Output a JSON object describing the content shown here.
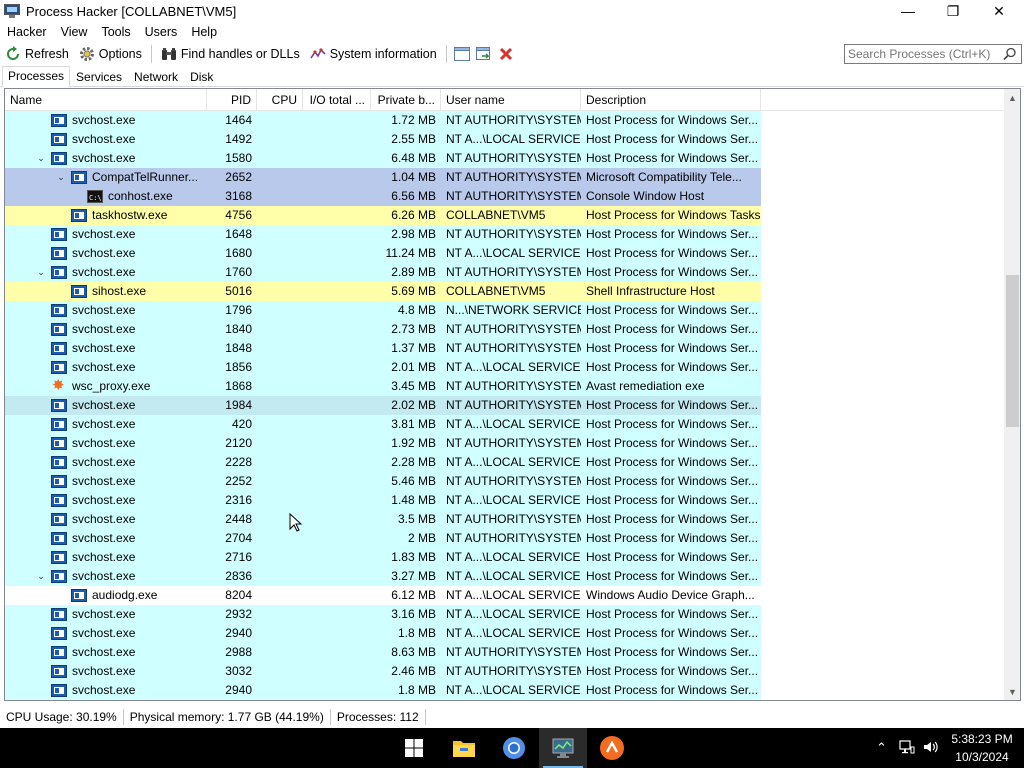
{
  "window": {
    "title": "Process Hacker [COLLABNET\\VM5]",
    "minimize": "—",
    "maximize": "❐",
    "close": "✕"
  },
  "menu": [
    "Hacker",
    "View",
    "Tools",
    "Users",
    "Help"
  ],
  "toolbar": {
    "refresh": "Refresh",
    "options": "Options",
    "find_handles": "Find handles or DLLs",
    "system_info": "System information",
    "search_placeholder": "Search Processes (Ctrl+K)"
  },
  "tabs": [
    "Processes",
    "Services",
    "Network",
    "Disk"
  ],
  "columns": [
    "Name",
    "PID",
    "CPU",
    "I/O total ...",
    "Private b...",
    "User name",
    "Description"
  ],
  "colors": {
    "service": "#d0ffff",
    "user": "#ffffaa",
    "selected": "#b9c9ec",
    "hover": "#c4eaf1",
    "plain": "#ffffff"
  },
  "processes": [
    {
      "name": "svchost.exe",
      "pid": "1464",
      "cpu": "",
      "io": "",
      "priv": "1.72 MB",
      "user": "NT AUTHORITY\\SYSTEM",
      "desc": "Host Process for Windows Ser...",
      "indent": 1,
      "twisty": "",
      "icon": "svc",
      "kind": "service"
    },
    {
      "name": "svchost.exe",
      "pid": "1492",
      "cpu": "",
      "io": "",
      "priv": "2.55 MB",
      "user": "NT A...\\LOCAL SERVICE",
      "desc": "Host Process for Windows Ser...",
      "indent": 1,
      "twisty": "",
      "icon": "svc",
      "kind": "service"
    },
    {
      "name": "svchost.exe",
      "pid": "1580",
      "cpu": "",
      "io": "",
      "priv": "6.48 MB",
      "user": "NT AUTHORITY\\SYSTEM",
      "desc": "Host Process for Windows Ser...",
      "indent": 1,
      "twisty": "⌄",
      "icon": "svc",
      "kind": "service"
    },
    {
      "name": "CompatTelRunner...",
      "pid": "2652",
      "cpu": "",
      "io": "",
      "priv": "1.04 MB",
      "user": "NT AUTHORITY\\SYSTEM",
      "desc": "Microsoft Compatibility Tele...",
      "indent": 2,
      "twisty": "⌄",
      "icon": "svc",
      "kind": "selected"
    },
    {
      "name": "conhost.exe",
      "pid": "3168",
      "cpu": "",
      "io": "",
      "priv": "6.56 MB",
      "user": "NT AUTHORITY\\SYSTEM",
      "desc": "Console Window Host",
      "indent": 3,
      "twisty": "",
      "icon": "cmd",
      "kind": "selected"
    },
    {
      "name": "taskhostw.exe",
      "pid": "4756",
      "cpu": "",
      "io": "",
      "priv": "6.26 MB",
      "user": "COLLABNET\\VM5",
      "desc": "Host Process for Windows Tasks",
      "indent": 2,
      "twisty": "",
      "icon": "svc",
      "kind": "user"
    },
    {
      "name": "svchost.exe",
      "pid": "1648",
      "cpu": "",
      "io": "",
      "priv": "2.98 MB",
      "user": "NT AUTHORITY\\SYSTEM",
      "desc": "Host Process for Windows Ser...",
      "indent": 1,
      "twisty": "",
      "icon": "svc",
      "kind": "service"
    },
    {
      "name": "svchost.exe",
      "pid": "1680",
      "cpu": "",
      "io": "",
      "priv": "11.24 MB",
      "user": "NT A...\\LOCAL SERVICE",
      "desc": "Host Process for Windows Ser...",
      "indent": 1,
      "twisty": "",
      "icon": "svc",
      "kind": "service"
    },
    {
      "name": "svchost.exe",
      "pid": "1760",
      "cpu": "",
      "io": "",
      "priv": "2.89 MB",
      "user": "NT AUTHORITY\\SYSTEM",
      "desc": "Host Process for Windows Ser...",
      "indent": 1,
      "twisty": "⌄",
      "icon": "svc",
      "kind": "service"
    },
    {
      "name": "sihost.exe",
      "pid": "5016",
      "cpu": "",
      "io": "",
      "priv": "5.69 MB",
      "user": "COLLABNET\\VM5",
      "desc": "Shell Infrastructure Host",
      "indent": 2,
      "twisty": "",
      "icon": "svc",
      "kind": "user"
    },
    {
      "name": "svchost.exe",
      "pid": "1796",
      "cpu": "",
      "io": "",
      "priv": "4.8 MB",
      "user": "N...\\NETWORK SERVICE",
      "desc": "Host Process for Windows Ser...",
      "indent": 1,
      "twisty": "",
      "icon": "svc",
      "kind": "service"
    },
    {
      "name": "svchost.exe",
      "pid": "1840",
      "cpu": "",
      "io": "",
      "priv": "2.73 MB",
      "user": "NT AUTHORITY\\SYSTEM",
      "desc": "Host Process for Windows Ser...",
      "indent": 1,
      "twisty": "",
      "icon": "svc",
      "kind": "service"
    },
    {
      "name": "svchost.exe",
      "pid": "1848",
      "cpu": "",
      "io": "",
      "priv": "1.37 MB",
      "user": "NT AUTHORITY\\SYSTEM",
      "desc": "Host Process for Windows Ser...",
      "indent": 1,
      "twisty": "",
      "icon": "svc",
      "kind": "service"
    },
    {
      "name": "svchost.exe",
      "pid": "1856",
      "cpu": "",
      "io": "",
      "priv": "2.01 MB",
      "user": "NT A...\\LOCAL SERVICE",
      "desc": "Host Process for Windows Ser...",
      "indent": 1,
      "twisty": "",
      "icon": "svc",
      "kind": "service"
    },
    {
      "name": "wsc_proxy.exe",
      "pid": "1868",
      "cpu": "",
      "io": "",
      "priv": "3.45 MB",
      "user": "NT AUTHORITY\\SYSTEM",
      "desc": "Avast remediation exe",
      "indent": 1,
      "twisty": "",
      "icon": "avast",
      "kind": "service"
    },
    {
      "name": "svchost.exe",
      "pid": "1984",
      "cpu": "",
      "io": "",
      "priv": "2.02 MB",
      "user": "NT AUTHORITY\\SYSTEM",
      "desc": "Host Process for Windows Ser...",
      "indent": 1,
      "twisty": "",
      "icon": "svc",
      "kind": "hover"
    },
    {
      "name": "svchost.exe",
      "pid": "420",
      "cpu": "",
      "io": "",
      "priv": "3.81 MB",
      "user": "NT A...\\LOCAL SERVICE",
      "desc": "Host Process for Windows Ser...",
      "indent": 1,
      "twisty": "",
      "icon": "svc",
      "kind": "service"
    },
    {
      "name": "svchost.exe",
      "pid": "2120",
      "cpu": "",
      "io": "",
      "priv": "1.92 MB",
      "user": "NT AUTHORITY\\SYSTEM",
      "desc": "Host Process for Windows Ser...",
      "indent": 1,
      "twisty": "",
      "icon": "svc",
      "kind": "service"
    },
    {
      "name": "svchost.exe",
      "pid": "2228",
      "cpu": "",
      "io": "",
      "priv": "2.28 MB",
      "user": "NT A...\\LOCAL SERVICE",
      "desc": "Host Process for Windows Ser...",
      "indent": 1,
      "twisty": "",
      "icon": "svc",
      "kind": "service"
    },
    {
      "name": "svchost.exe",
      "pid": "2252",
      "cpu": "",
      "io": "",
      "priv": "5.46 MB",
      "user": "NT AUTHORITY\\SYSTEM",
      "desc": "Host Process for Windows Ser...",
      "indent": 1,
      "twisty": "",
      "icon": "svc",
      "kind": "service"
    },
    {
      "name": "svchost.exe",
      "pid": "2316",
      "cpu": "",
      "io": "",
      "priv": "1.48 MB",
      "user": "NT A...\\LOCAL SERVICE",
      "desc": "Host Process for Windows Ser...",
      "indent": 1,
      "twisty": "",
      "icon": "svc",
      "kind": "service"
    },
    {
      "name": "svchost.exe",
      "pid": "2448",
      "cpu": "",
      "io": "",
      "priv": "3.5 MB",
      "user": "NT AUTHORITY\\SYSTEM",
      "desc": "Host Process for Windows Ser...",
      "indent": 1,
      "twisty": "",
      "icon": "svc",
      "kind": "service"
    },
    {
      "name": "svchost.exe",
      "pid": "2704",
      "cpu": "",
      "io": "",
      "priv": "2 MB",
      "user": "NT AUTHORITY\\SYSTEM",
      "desc": "Host Process for Windows Ser...",
      "indent": 1,
      "twisty": "",
      "icon": "svc",
      "kind": "service"
    },
    {
      "name": "svchost.exe",
      "pid": "2716",
      "cpu": "",
      "io": "",
      "priv": "1.83 MB",
      "user": "NT A...\\LOCAL SERVICE",
      "desc": "Host Process for Windows Ser...",
      "indent": 1,
      "twisty": "",
      "icon": "svc",
      "kind": "service"
    },
    {
      "name": "svchost.exe",
      "pid": "2836",
      "cpu": "",
      "io": "",
      "priv": "3.27 MB",
      "user": "NT A...\\LOCAL SERVICE",
      "desc": "Host Process for Windows Ser...",
      "indent": 1,
      "twisty": "⌄",
      "icon": "svc",
      "kind": "service"
    },
    {
      "name": "audiodg.exe",
      "pid": "8204",
      "cpu": "",
      "io": "",
      "priv": "6.12 MB",
      "user": "NT A...\\LOCAL SERVICE",
      "desc": "Windows Audio Device Graph...",
      "indent": 2,
      "twisty": "",
      "icon": "svc",
      "kind": "plain"
    },
    {
      "name": "svchost.exe",
      "pid": "2932",
      "cpu": "",
      "io": "",
      "priv": "3.16 MB",
      "user": "NT A...\\LOCAL SERVICE",
      "desc": "Host Process for Windows Ser...",
      "indent": 1,
      "twisty": "",
      "icon": "svc",
      "kind": "service"
    },
    {
      "name": "svchost.exe",
      "pid": "2940",
      "cpu": "",
      "io": "",
      "priv": "1.8 MB",
      "user": "NT A...\\LOCAL SERVICE",
      "desc": "Host Process for Windows Ser...",
      "indent": 1,
      "twisty": "",
      "icon": "svc",
      "kind": "service"
    },
    {
      "name": "svchost.exe",
      "pid": "2988",
      "cpu": "",
      "io": "",
      "priv": "8.63 MB",
      "user": "NT AUTHORITY\\SYSTEM",
      "desc": "Host Process for Windows Ser...",
      "indent": 1,
      "twisty": "",
      "icon": "svc",
      "kind": "service"
    },
    {
      "name": "svchost.exe",
      "pid": "3032",
      "cpu": "",
      "io": "",
      "priv": "2.46 MB",
      "user": "NT AUTHORITY\\SYSTEM",
      "desc": "Host Process for Windows Ser...",
      "indent": 1,
      "twisty": "",
      "icon": "svc",
      "kind": "service"
    },
    {
      "name": "svchost.exe",
      "pid": "2940",
      "cpu": "",
      "io": "",
      "priv": "1.8 MB",
      "user": "NT A...\\LOCAL SERVICE",
      "desc": "Host Process for Windows Ser...",
      "indent": 1,
      "twisty": "",
      "icon": "svc",
      "kind": "service"
    }
  ],
  "status": {
    "cpu": "CPU Usage: 30.19%",
    "memory": "Physical memory: 1.77 GB (44.19%)",
    "processes": "Processes: 112"
  },
  "taskbar": {
    "time": "5:38:23 PM",
    "date": "10/3/2024"
  }
}
